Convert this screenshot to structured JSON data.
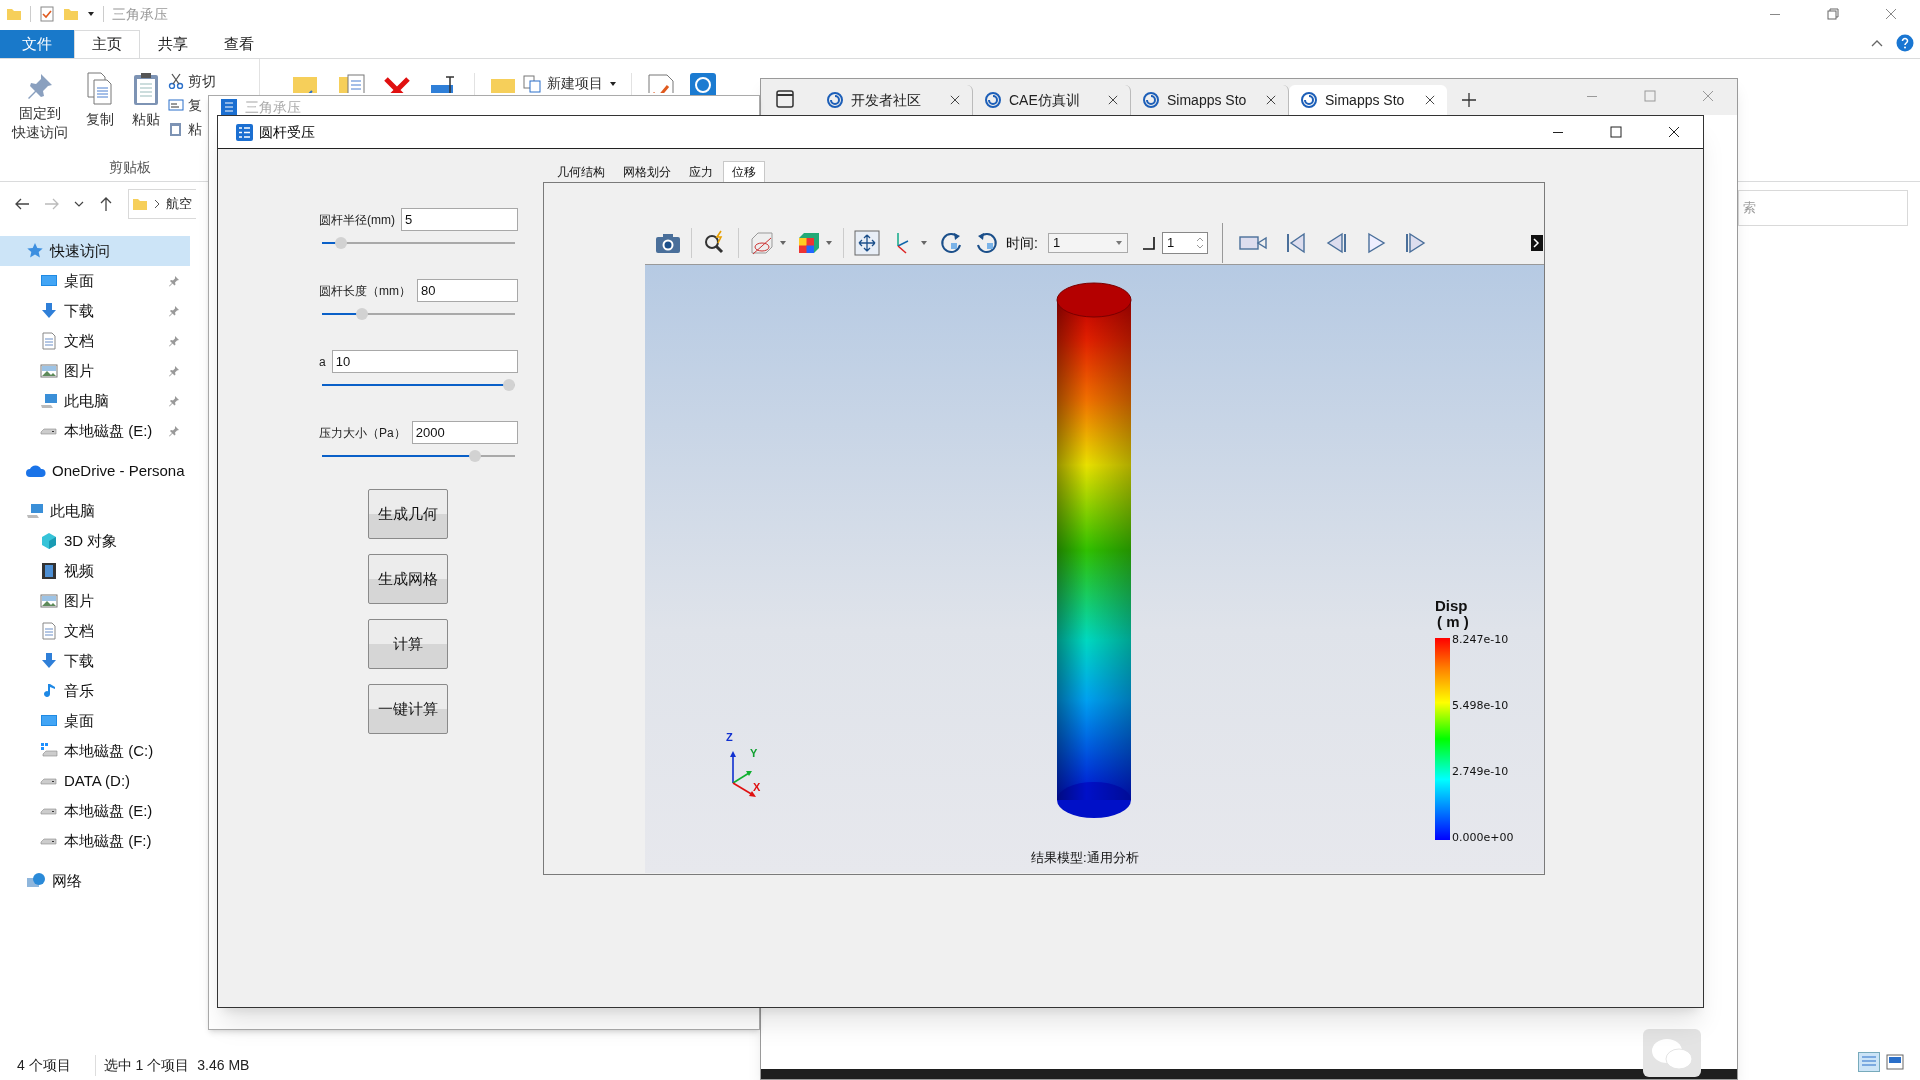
{
  "explorer": {
    "title": "三角承压",
    "ribbon_tabs": [
      {
        "label": "文件",
        "kind": "file",
        "selected": false
      },
      {
        "label": "主页",
        "kind": "tab",
        "selected": true
      },
      {
        "label": "共享",
        "kind": "tab",
        "selected": false
      },
      {
        "label": "查看",
        "kind": "tab",
        "selected": false
      }
    ],
    "clipboard": {
      "pin": [
        "固定到",
        "快速访问"
      ],
      "copy": "复制",
      "paste": "粘贴",
      "small_buttons": [
        "剪切",
        "复",
        "粘"
      ],
      "group_label": "剪贴板"
    },
    "new_item": "新建项目",
    "path": "航空",
    "search": {
      "placeholder": "索"
    },
    "sidebar": [
      {
        "label": "快速访问",
        "kind": "star",
        "selected": true,
        "children": [
          {
            "label": "桌面",
            "kind": "desktop",
            "selected": false,
            "pinned": true
          },
          {
            "label": "下载",
            "kind": "download",
            "selected": false,
            "pinned": true
          },
          {
            "label": "文档",
            "kind": "document",
            "selected": false,
            "pinned": true
          },
          {
            "label": "图片",
            "kind": "pictures",
            "selected": false,
            "pinned": true
          },
          {
            "label": "此电脑",
            "kind": "computer",
            "selected": false,
            "pinned": true
          },
          {
            "label": "本地磁盘 (E:)",
            "kind": "drive",
            "selected": false,
            "pinned": true
          }
        ]
      },
      {
        "label": "OneDrive - Persona",
        "kind": "cloud",
        "selected": false
      },
      {
        "label": "此电脑",
        "kind": "computer",
        "selected": false,
        "children": [
          {
            "label": "3D 对象",
            "kind": "cube",
            "selected": false
          },
          {
            "label": "视频",
            "kind": "video",
            "selected": false
          },
          {
            "label": "图片",
            "kind": "pictures",
            "selected": false
          },
          {
            "label": "文档",
            "kind": "document",
            "selected": false
          },
          {
            "label": "下载",
            "kind": "download",
            "selected": false
          },
          {
            "label": "音乐",
            "kind": "music",
            "selected": false
          },
          {
            "label": "桌面",
            "kind": "desktop",
            "selected": false
          },
          {
            "label": "本地磁盘 (C:)",
            "kind": "system_drive",
            "selected": false
          },
          {
            "label": "DATA (D:)",
            "kind": "drive",
            "selected": false
          },
          {
            "label": "本地磁盘 (E:)",
            "kind": "drive",
            "selected": false
          },
          {
            "label": "本地磁盘 (F:)",
            "kind": "drive",
            "selected": false
          }
        ]
      },
      {
        "label": "网络",
        "kind": "network",
        "selected": false
      }
    ],
    "status_bar": [
      "4 个项目",
      "选中 1 个项目",
      "3.46 MB"
    ]
  },
  "back_window": {
    "title": "三角承压"
  },
  "browser": {
    "tabs": [
      {
        "label": "开发者社区",
        "selected": false
      },
      {
        "label": "CAE仿真训",
        "selected": false
      },
      {
        "label": "Simapps Sto",
        "selected": false
      },
      {
        "label": "Simapps Sto",
        "selected": true
      }
    ]
  },
  "app": {
    "title": "圆杆受压",
    "params": [
      {
        "label": "圆杆半径(mm)",
        "value": "5",
        "level": 0.07
      },
      {
        "label": "圆杆长度（mm）",
        "value": "80",
        "level": 0.19
      },
      {
        "label": "a",
        "value": "10",
        "level": 1.0
      },
      {
        "label": "压力大小（Pa）",
        "value": "2000",
        "level": 0.81
      }
    ],
    "buttons": [
      "生成几何",
      "生成网格",
      "计算",
      "一键计算"
    ],
    "tabs": [
      {
        "label": "几何结构",
        "selected": false
      },
      {
        "label": "网格划分",
        "selected": false
      },
      {
        "label": "应力",
        "selected": false
      },
      {
        "label": "位移",
        "selected": true
      }
    ],
    "viewer": {
      "time_label": "时间:",
      "time_value": "1",
      "step_value": "1",
      "triad": [
        "Z",
        "Y",
        "X"
      ],
      "legend": {
        "title": "Disp",
        "unit": "( m )",
        "ticks": [
          "8.247e-10",
          "5.498e-10",
          "2.749e-10",
          "0.000e+00"
        ]
      },
      "caption": "结果模型:通用分析"
    }
  }
}
